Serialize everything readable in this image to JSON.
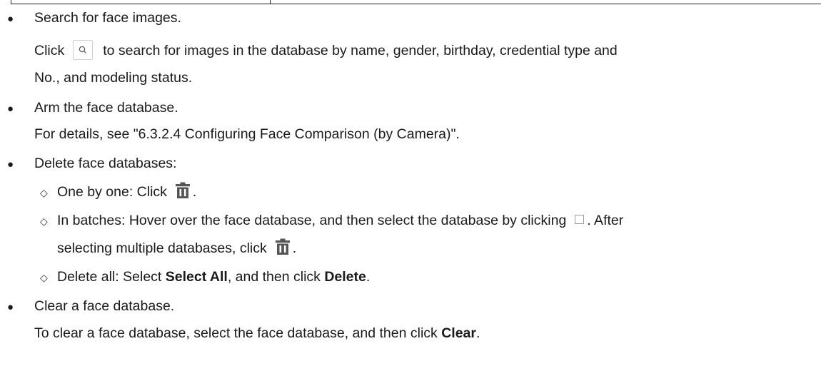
{
  "items": [
    {
      "title": "Search for face images.",
      "desc_line1_before": "Click",
      "desc_line1_after": "to search for images in the database by name, gender, birthday, credential type and",
      "desc_line2": "No., and modeling status."
    },
    {
      "title": "Arm the face database.",
      "desc": "For details, see \"6.3.2.4 Configuring Face Comparison (by Camera)\"."
    },
    {
      "title": "Delete face databases:",
      "sub": [
        {
          "text": "One by one: Click",
          "after": "."
        },
        {
          "text": "In batches: Hover over the face database, and then select the database by clicking",
          "after": ". After",
          "line2": "selecting multiple databases, click",
          "line2_after": "."
        },
        {
          "text1": "Delete all: Select",
          "bold1": "Select All",
          "text2": ", and then click",
          "bold2": "Delete",
          "text3": "."
        }
      ]
    },
    {
      "title": "Clear a face database.",
      "desc_text": "To clear a face database, select the face database, and then click",
      "desc_bold": "Clear",
      "desc_end": "."
    }
  ],
  "symbols": {
    "bullet": "●",
    "sub_bullet": "◇"
  },
  "icons": {
    "search": "search-icon",
    "trash": "trash-icon",
    "checkbox": "checkbox-icon"
  },
  "colors": {
    "text": "#1a1a1a",
    "trash_fill": "#555555"
  }
}
